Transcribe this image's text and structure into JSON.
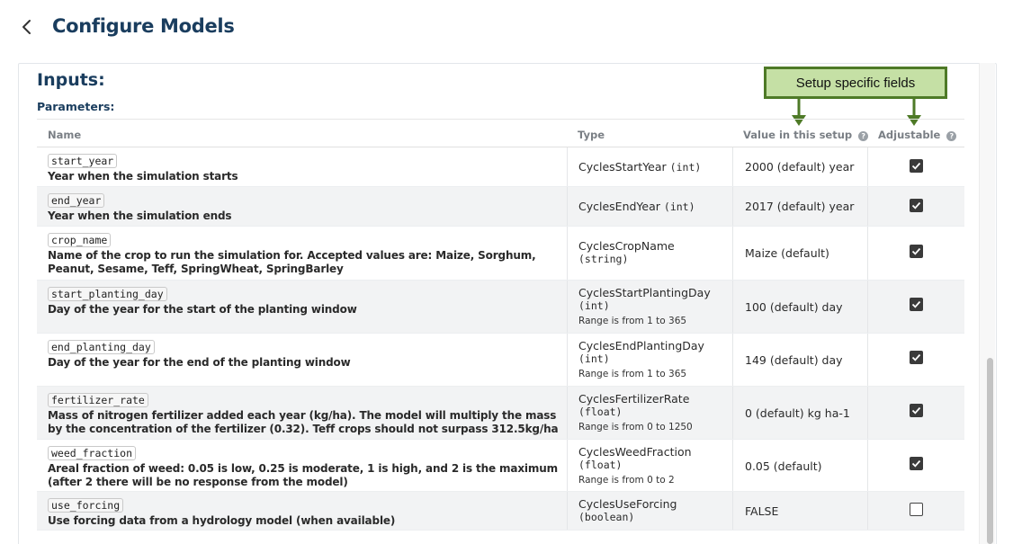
{
  "page": {
    "title": "Configure Models"
  },
  "inputs": {
    "title": "Inputs:",
    "parameters_title": "Parameters:"
  },
  "callout": {
    "label": "Setup specific fields"
  },
  "table": {
    "headers": {
      "name": "Name",
      "type": "Type",
      "value": "Value in this setup",
      "adjustable": "Adjustable"
    },
    "rows": [
      {
        "name": "start_year",
        "description": "Year when the simulation starts",
        "type": "CyclesStartYear",
        "type_kind": "(int)",
        "range": "",
        "value": "2000 (default) year",
        "adjustable": true
      },
      {
        "name": "end_year",
        "description": "Year when the simulation ends",
        "type": "CyclesEndYear",
        "type_kind": "(int)",
        "range": "",
        "value": "2017 (default) year",
        "adjustable": true
      },
      {
        "name": "crop_name",
        "description": "Name of the crop to run the simulation for. Accepted values are: Maize, Sorghum, Peanut, Sesame, Teff, SpringWheat, SpringBarley",
        "type": "CyclesCropName",
        "type_kind": "(string)",
        "range": "",
        "value": "Maize (default)",
        "adjustable": true
      },
      {
        "name": "start_planting_day",
        "description": "Day of the year for the start of the planting window",
        "type": "CyclesStartPlantingDay",
        "type_kind": "(int)",
        "range": "Range is from 1 to 365",
        "value": "100 (default) day",
        "adjustable": true
      },
      {
        "name": "end_planting_day",
        "description": "Day of the year for the end of the planting window",
        "type": "CyclesEndPlantingDay",
        "type_kind": "(int)",
        "range": "Range is from 1 to 365",
        "value": "149 (default) day",
        "adjustable": true
      },
      {
        "name": "fertilizer_rate",
        "description": "Mass of nitrogen fertilizer added each year (kg/ha). The model will multiply the mass by the concentration of the fertilizer (0.32). Teff crops should not surpass 312.5kg/ha",
        "type": "CyclesFertilizerRate",
        "type_kind": "(float)",
        "range": "Range is from 0 to 1250",
        "value": "0 (default) kg ha-1",
        "adjustable": true
      },
      {
        "name": "weed_fraction",
        "description": "Areal fraction of weed: 0.05 is low, 0.25 is moderate, 1 is high, and 2 is the maximum (after 2 there will be no response from the model)",
        "type": "CyclesWeedFraction",
        "type_kind": "(float)",
        "range": "Range is from 0 to 2",
        "value": "0.05 (default)",
        "adjustable": true
      },
      {
        "name": "use_forcing",
        "description": "Use forcing data from a hydrology model (when available)",
        "type": "CyclesUseForcing",
        "type_kind": "(boolean)",
        "range": "",
        "value": "FALSE",
        "adjustable": false
      }
    ]
  },
  "colors": {
    "title": "#1a3d5e",
    "callout_fill": "#c5e0a5",
    "callout_border": "#4e7a27",
    "row_alt": "#f2f3f4"
  },
  "icons": {
    "back": "chevron-left-icon",
    "help": "question-circle-icon",
    "check": "checkbox-icon"
  }
}
